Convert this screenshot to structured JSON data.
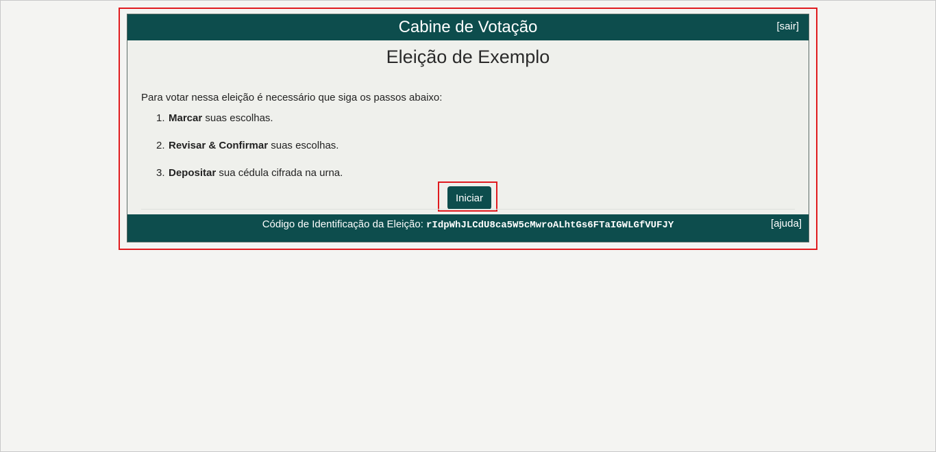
{
  "header": {
    "title": "Cabine de Votação",
    "logout_label": "[sair]"
  },
  "election": {
    "title": "Eleição de Exemplo"
  },
  "instructions": {
    "intro": "Para votar nessa eleição é necessário que siga os passos abaixo:",
    "steps": [
      {
        "number": "1.",
        "bold": "Marcar",
        "rest": " suas escolhas."
      },
      {
        "number": "2.",
        "bold": "Revisar & Confirmar",
        "rest": " suas escolhas."
      },
      {
        "number": "3.",
        "bold": "Depositar",
        "rest": " sua cédula cifrada na urna."
      }
    ]
  },
  "actions": {
    "start_label": "Iniciar"
  },
  "footer": {
    "code_label": "Código de Identificação da Eleição: ",
    "code_value": "rIdpWhJLCdU8ca5W5cMwroALhtGs6FTaIGWLGfVUFJY",
    "help_label": "[ajuda]"
  },
  "colors": {
    "brand": "#0d4d4d",
    "highlight": "#e0191d",
    "panel_background": "#eff0ec"
  }
}
